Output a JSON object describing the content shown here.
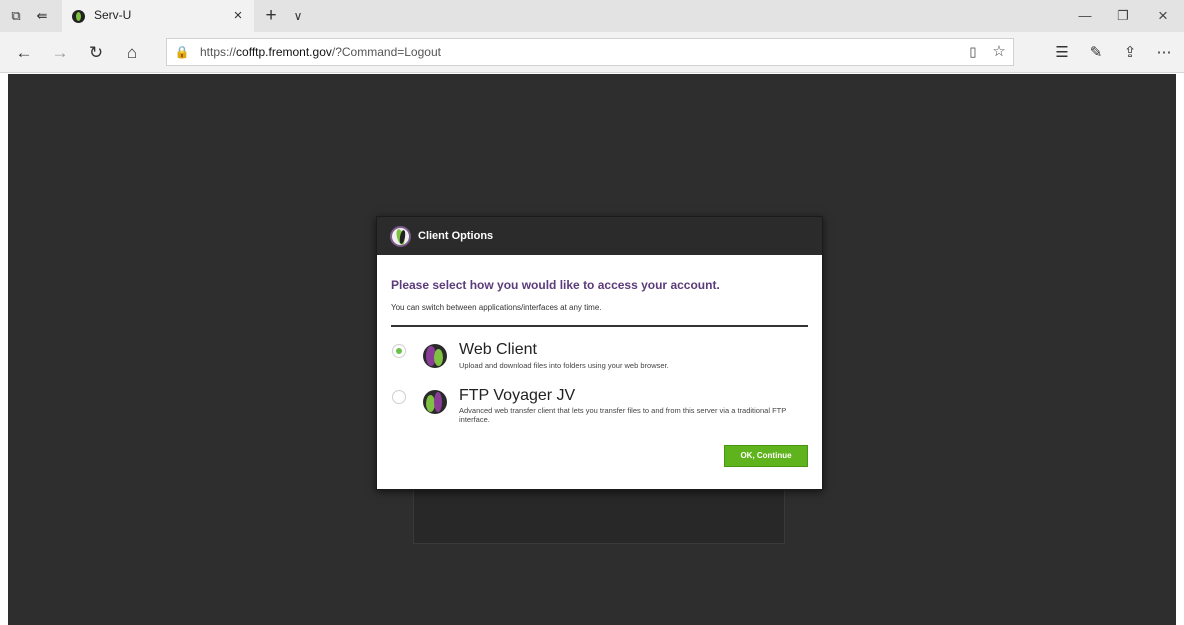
{
  "browser": {
    "tab": {
      "title": "Serv-U"
    },
    "address": {
      "scheme": "https://",
      "host": "cofftp.fremont.gov",
      "path": "/?Command=Logout"
    }
  },
  "icons": {
    "tab_aside": "⧉",
    "tab_back": "⇚",
    "close": "×",
    "new_tab": "+",
    "tab_menu": "∨",
    "minimize": "—",
    "restore": "❐",
    "close_window": "×",
    "back": "←",
    "forward": "→",
    "refresh": "↻",
    "home": "⌂",
    "lock": "🔒",
    "reading_view": "▯",
    "favorite": "☆",
    "favorites_hub": "☰",
    "pen": "✎",
    "share": "⇪",
    "more": "⋯"
  },
  "dialog": {
    "title": "Client Options",
    "prompt": "Please select how you would like to access your account.",
    "subtext": "You can switch between applications/interfaces at any time.",
    "options": [
      {
        "title": "Web Client",
        "description": "Upload and download files into folders using your web browser.",
        "selected": true
      },
      {
        "title": "FTP Voyager JV",
        "description": "Advanced web transfer client that lets you transfer files to and from this server via a traditional FTP interface.",
        "selected": false
      }
    ],
    "ok_label": "OK, Continue"
  },
  "colors": {
    "backdrop": "#2e2e2e",
    "header": "#2b2b2b",
    "prompt": "#5c3b7a",
    "accent_green": "#5fb31c"
  }
}
